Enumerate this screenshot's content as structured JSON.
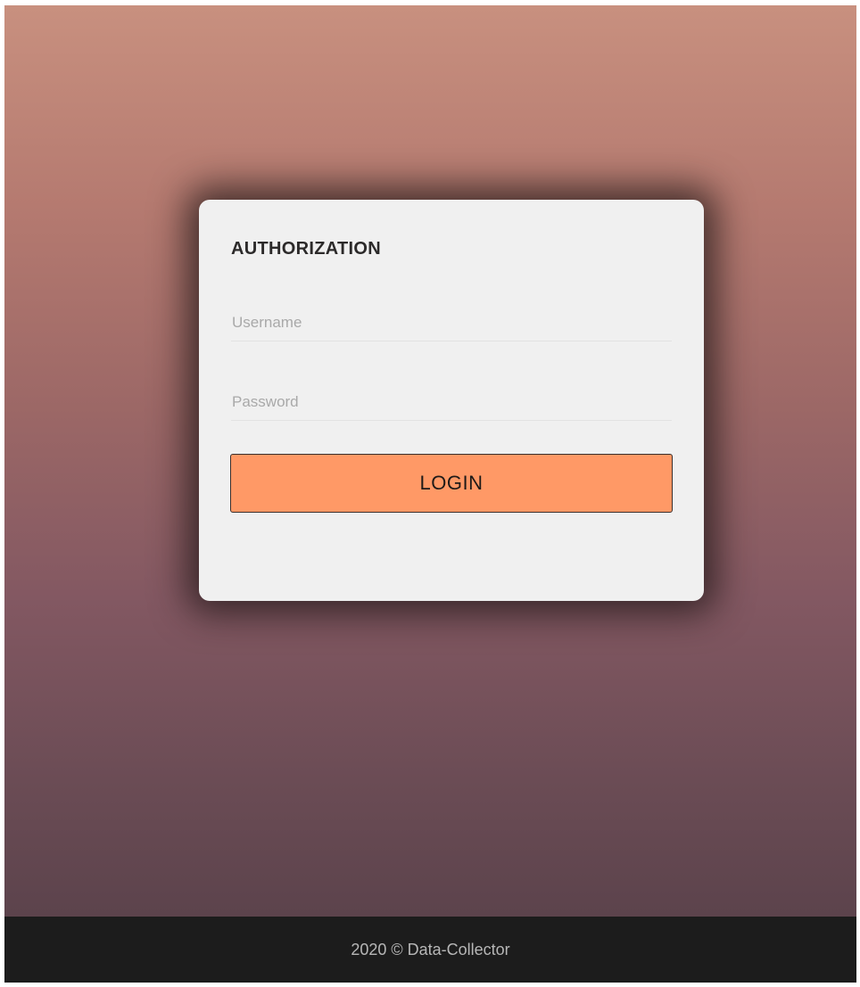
{
  "login_card": {
    "title": "AUTHORIZATION",
    "username_placeholder": "Username",
    "username_value": "",
    "password_placeholder": "Password",
    "password_value": "",
    "login_label": "LOGIN"
  },
  "footer": {
    "text": "2020 © Data-Collector"
  },
  "colors": {
    "background_top": "#c8907f",
    "background_bottom": "#5c434c",
    "card": "#f0f0f0",
    "button": "#ff9966",
    "footer": "#1c1c1c"
  }
}
